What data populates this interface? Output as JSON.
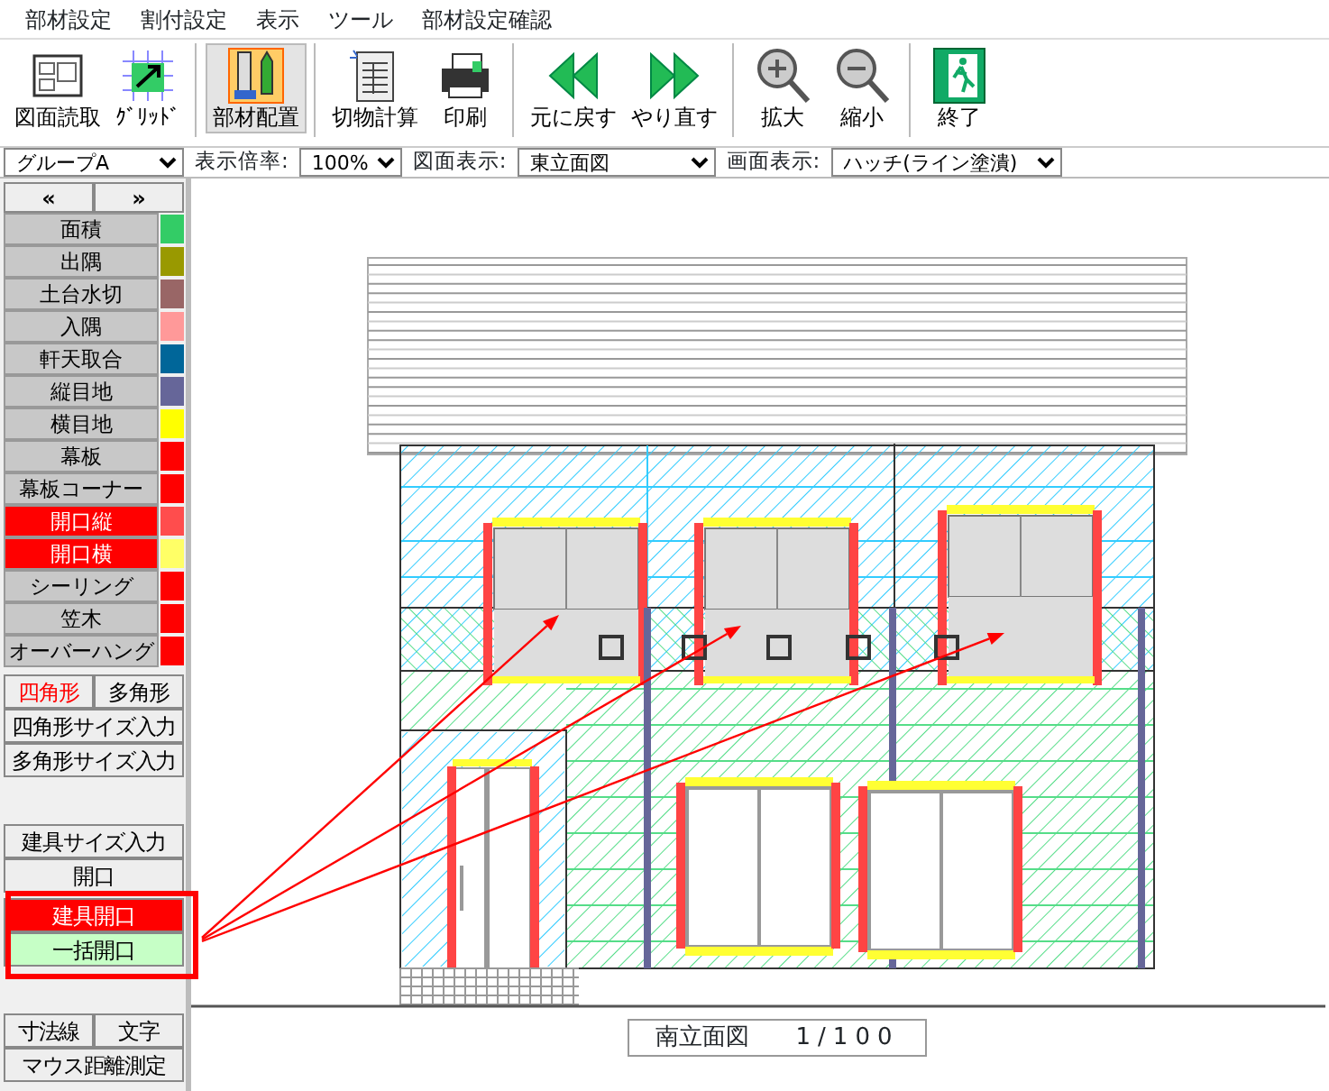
{
  "menu": [
    {
      "label": "部材設定"
    },
    {
      "label": "割付設定"
    },
    {
      "label": "表示"
    },
    {
      "label": "ツール"
    },
    {
      "label": "部材設定確認"
    }
  ],
  "toolbar": [
    [
      {
        "label": "図面読取",
        "kind": "plan",
        "selected": false
      },
      {
        "label": "ｸﾞﾘｯﾄﾞ",
        "kind": "grid",
        "selected": false
      }
    ],
    [
      {
        "label": "部材配置",
        "kind": "ruler",
        "selected": true
      }
    ],
    [
      {
        "label": "切物計算",
        "kind": "sheet",
        "selected": false
      },
      {
        "label": "印刷",
        "kind": "printer",
        "selected": false
      }
    ],
    [
      {
        "label": "元に戻す",
        "kind": "undo",
        "selected": false
      },
      {
        "label": "やり直す",
        "kind": "redo",
        "selected": false
      }
    ],
    [
      {
        "label": "拡大",
        "kind": "zoomin",
        "selected": false
      },
      {
        "label": "縮小",
        "kind": "zoomout",
        "selected": false
      }
    ],
    [
      {
        "label": "終了",
        "kind": "exit",
        "selected": false
      }
    ]
  ],
  "selectors": [
    {
      "value": "グループA"
    },
    {
      "label": "表示倍率:",
      "value": "100%"
    },
    {
      "label": "図面表示:",
      "value": "東立面図"
    },
    {
      "label": "画面表示:",
      "value": "ハッチ(ライン塗潰)"
    }
  ],
  "sidebar": {
    "nav": [
      "«",
      "»"
    ],
    "materials": [
      {
        "label": "面積",
        "color": "#33cc66",
        "selected": false
      },
      {
        "label": "出隅",
        "color": "#999900",
        "selected": false
      },
      {
        "label": "土台水切",
        "color": "#996666",
        "selected": false
      },
      {
        "label": "入隅",
        "color": "#ff9999",
        "selected": false
      },
      {
        "label": "軒天取合",
        "color": "#006699",
        "selected": false
      },
      {
        "label": "縦目地",
        "color": "#666699",
        "selected": false
      },
      {
        "label": "横目地",
        "color": "#ffff00",
        "selected": false
      },
      {
        "label": "幕板",
        "color": "#ff0000",
        "selected": false
      },
      {
        "label": "幕板コーナー",
        "color": "#ff0000",
        "selected": false
      },
      {
        "label": "開口縦",
        "color": "#ff4d4d",
        "selected": true
      },
      {
        "label": "開口横",
        "color": "#ffff66",
        "selected": true
      },
      {
        "label": "シーリング",
        "color": "#ff0000",
        "selected": false
      },
      {
        "label": "笠木",
        "color": "#ff0000",
        "selected": false
      },
      {
        "label": "オーバーハング",
        "color": "#ff0000",
        "selected": false
      }
    ],
    "groups": [
      [
        [
          {
            "label": "四角形",
            "kind": "current"
          },
          {
            "label": "多角形",
            "kind": "plain"
          }
        ],
        [
          {
            "label": "四角形サイズ入力",
            "kind": "plain"
          }
        ],
        [
          {
            "label": "多角形サイズ入力",
            "kind": "plain"
          }
        ]
      ],
      [
        [
          {
            "label": "建具サイズ入力",
            "kind": "plain"
          }
        ],
        [
          {
            "label": "開口",
            "kind": "plain"
          }
        ],
        [
          {
            "label": "建具開口",
            "kind": "danger"
          }
        ],
        [
          {
            "label": "一括開口",
            "kind": "success"
          }
        ]
      ],
      [
        [
          {
            "label": "寸法線",
            "kind": "plain"
          },
          {
            "label": "文字",
            "kind": "plain"
          }
        ],
        [
          {
            "label": "マウス距離測定",
            "kind": "plain"
          }
        ]
      ]
    ]
  },
  "drawing": {
    "title": "南立面図",
    "scale": "1/100"
  }
}
